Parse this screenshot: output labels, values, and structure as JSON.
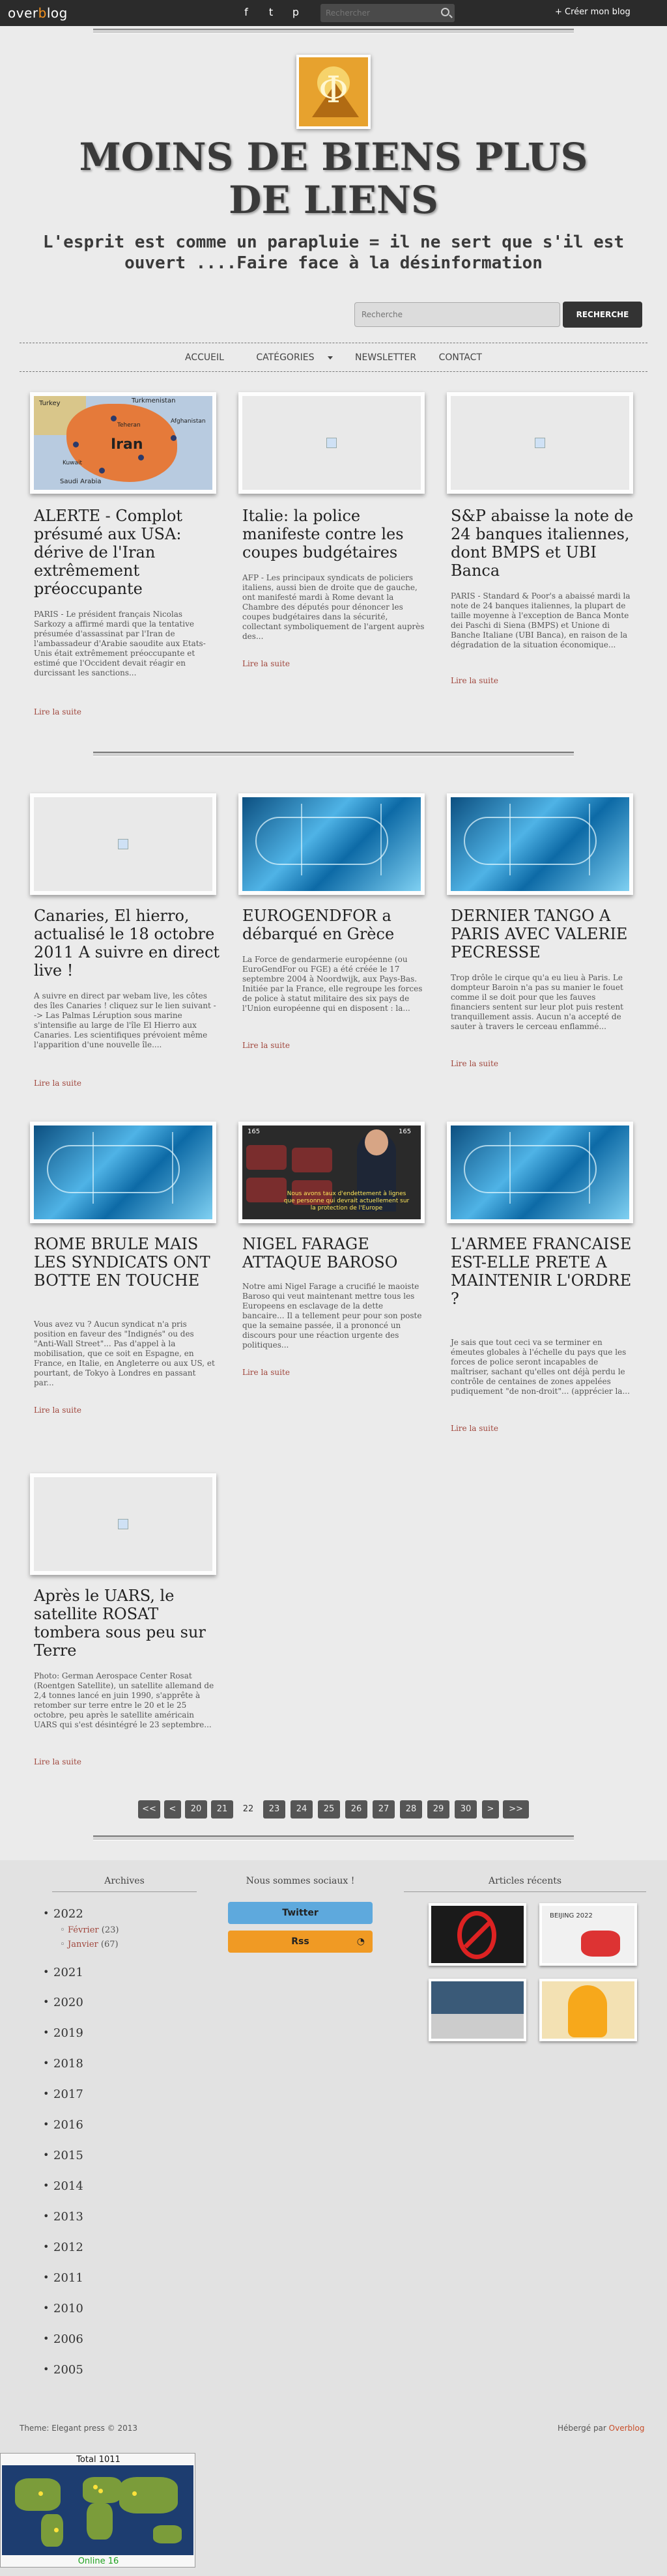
{
  "topbar": {
    "logo_a": "over",
    "logo_o": "b",
    "logo_b": "log",
    "search_placeholder": "Rechercher",
    "create_blog": "+ Créer mon blog"
  },
  "header": {
    "title": "MOINS DE BIENS PLUS DE LIENS",
    "subtitle": "L'esprit est comme un parapluie = il ne sert que s'il est ouvert ....Faire face à la désinformation",
    "search_placeholder": "Recherche",
    "search_button": "RECHERCHE"
  },
  "nav": {
    "items": [
      "ACCUEIL",
      "CATÉGORIES",
      "NEWSLETTER",
      "CONTACT"
    ]
  },
  "articles": [
    {
      "title": "ALERTE - Complot présumé aux USA: dérive de l'Iran extrêmement préoccupante",
      "excerpt": "PARIS - Le président français Nicolas Sarkozy a affirmé mardi que la tentative présumée d'assassinat par l'Iran de l'ambassadeur d'Arabie saoudite aux Etats-Unis était extrêmement préoccupante et estimé que l'Occident devait réagir en durcissant les sanctions...",
      "more": "Lire la suite"
    },
    {
      "title": "Italie: la police manifeste contre les coupes budgétaires",
      "excerpt": "AFP - Les principaux syndicats de policiers italiens, aussi bien de droite que de gauche, ont manifesté mardi à Rome devant la Chambre des députés pour dénoncer les coupes budgétaires dans la sécurité, collectant symboliquement de l'argent auprès des...",
      "more": "Lire la suite"
    },
    {
      "title": "S&P abaisse la note de 24 banques italiennes, dont BMPS et UBI Banca",
      "excerpt": "PARIS - Standard & Poor's a abaissé mardi la note de 24 banques italiennes, la plupart de taille moyenne à l'exception de Banca Monte dei Paschi di Siena (BMPS) et Unione di Banche Italiane (UBI Banca), en raison de la dégradation de la situation économique...",
      "more": "Lire la suite"
    },
    {
      "title": "Canaries, El hierro, actualisé le 18 octobre 2011 A suivre en direct live !",
      "excerpt": "A suivre en direct par webam live, les côtes des îles Canaries ! cliquez sur le lien suivant --> Las Palmas Léruption sous marine s'intensifie au large de l'île El Hierro aux Canaries. Les scientifiques prévoient même l'apparition d'une nouvelle île....",
      "more": "Lire la suite"
    },
    {
      "title": "EUROGENDFOR a débarqué en Grèce",
      "excerpt": "La Force de gendarmerie européenne (ou EuroGendFor ou FGE) a été créée le 17 septembre 2004 à Noordwijk, aux Pays-Bas. Initiée par la France, elle regroupe les forces de police à statut militaire des six pays de l'Union européenne qui en disposent : la...",
      "more": "Lire la suite"
    },
    {
      "title": "DERNIER TANGO A PARIS AVEC VALERIE PECRESSE",
      "excerpt": "Trop drôle le cirque qu'a eu lieu à Paris. Le dompteur Baroin n'a pas su manier le fouet comme il se doit pour que les fauves financiers sentent sur leur plot puis restent tranquillement assis. Aucun n'a accepté de sauter à travers le cerceau enflammé...",
      "more": "Lire la suite"
    },
    {
      "title": "ROME BRULE MAIS LES SYNDICATS ONT BOTTE EN TOUCHE",
      "excerpt": "Vous avez vu ? Aucun syndicat n'a pris position en faveur des \"Indignés\" ou des \"Anti-Wall Street\"... Pas d'appel à la mobilisation, que ce soit en Espagne, en France, en Italie, en Angleterre ou aux US, et pourtant, de Tokyo à Londres en passant par...",
      "more": "Lire la suite"
    },
    {
      "title": "NIGEL FARAGE ATTAQUE BAROSO",
      "excerpt": "Notre ami Nigel Farage a crucifié le maoiste Baroso qui veut maintenant mettre tous les Europeens en esclavage de la dette bancaire... Il a tellement peur pour son poste que la semaine passée, il a prononcé un discours pour une réaction urgente des politiques...",
      "more": "Lire la suite"
    },
    {
      "title": "L'ARMEE FRANCAISE EST-ELLE PRETE A MAINTENIR L'ORDRE ?",
      "excerpt": "Je sais que tout ceci va se terminer en émeutes globales à l'échelle du pays que les forces de police seront incapables de maîtriser, sachant qu'elles ont déjà perdu le contrôle de centaines de zones appelées pudiquement \"de non-droit\"... (apprécier la...",
      "more": "Lire la suite"
    },
    {
      "title": "Après le UARS, le satellite ROSAT tombera sous peu sur Terre",
      "excerpt": "Photo: German Aerospace Center Rosat (Roentgen Satellite), un satellite allemand de 2,4 tonnes lancé en juin 1990, s'apprête à retomber sur terre entre le 20 et le 25 octobre, peu après le satellite américain UARS qui s'est désintégré le 23 septembre...",
      "more": "Lire la suite"
    }
  ],
  "thumb_text": {
    "iran": "Iran",
    "tehran": "Teheran",
    "turkey": "Turkey",
    "kuwait": "Kuwait",
    "saudi": "Saudi Arabia",
    "turkmen": "Turkmenistan",
    "afgh": "Afghanistan",
    "video_sub": "Nous avons taux d'endettement à lignes que personne qui devrait actuellement sur la protection de l'Europe",
    "video_n1": "165",
    "video_n2": "165"
  },
  "pagination": [
    "<<",
    "<",
    "20",
    "21",
    "22",
    "23",
    "24",
    "25",
    "26",
    "27",
    "28",
    "29",
    "30",
    ">",
    ">>"
  ],
  "pagination_current": "22",
  "footer": {
    "archives_title": "Archives",
    "social_title": "Nous sommes sociaux !",
    "recent_title": "Articles récents",
    "years": [
      "2022",
      "2021",
      "2020",
      "2019",
      "2018",
      "2017",
      "2016",
      "2015",
      "2014",
      "2013",
      "2012",
      "2011",
      "2010",
      "2006",
      "2005"
    ],
    "months": [
      {
        "name": "Février",
        "count": "(23)"
      },
      {
        "name": "Janvier",
        "count": "(67)"
      }
    ],
    "twitter": "Twitter",
    "rss": "Rss",
    "recent_labels": [
      "",
      "BEIJING 2022",
      "",
      ""
    ],
    "theme": "Theme: Elegant press © 2013",
    "hosted_prefix": "Hébergé par ",
    "hosted_link": "Overblog"
  },
  "widget": {
    "total": "Total 1011",
    "online": "Online 16"
  },
  "colors": {
    "accent": "#a0463c",
    "topbar": "#2b2b2b",
    "twitter": "#5ea9dd",
    "rss": "#f09a24"
  }
}
